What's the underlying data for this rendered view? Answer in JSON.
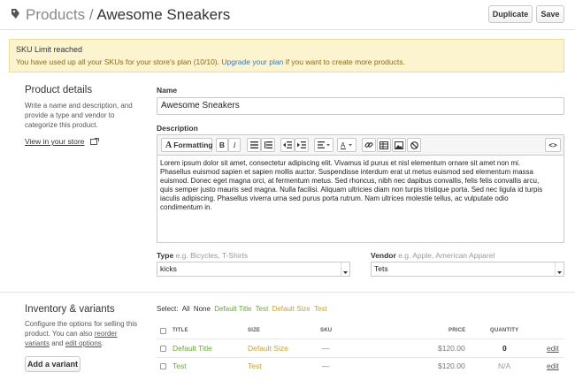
{
  "header": {
    "breadcrumb_root": "Products",
    "separator": "/",
    "title": "Awesome Sneakers",
    "duplicate_label": "Duplicate",
    "save_label": "Save"
  },
  "banner": {
    "title": "SKU Limit reached",
    "text_before": "You have used up all your SKUs for your store's plan (10/10).",
    "link": "Upgrade your plan",
    "text_after": "if you want to create more products."
  },
  "details": {
    "title": "Product details",
    "description": [
      "Write a name and description, and",
      "provide a type and vendor to",
      "categorize this product."
    ],
    "view_link": "View in your store"
  },
  "name_field": {
    "label": "Name",
    "value": "Awesome Sneakers"
  },
  "description_field": {
    "label": "Description",
    "toolbar": {
      "formatting": "Formatting",
      "bold": "B",
      "italic": "I",
      "code": "<>"
    },
    "lines": [
      "Lorem ipsum dolor sit amet, consectetur adipiscing elit. Vivamus id purus et nisl elementum ornare sit amet non mi.",
      "Phasellus euismod sapien et sapien mollis auctor. Suspendisse interdum erat ut metus euismod sed elementum massa",
      "euismod. Donec eget magna orci, at fermentum metus. Sed rhoncus, nibh nec dapibus convallis, felis felis convallis arcu,",
      "quis semper justo mauris sed magna. Nulla facilisi. Aliquam ultricies diam non turpis tristique porta. Sed nec ligula id turpis",
      "iaculis adipiscing. Phasellus viverra urna sed purus porta rutrum. Nam ultrices molestie tellus, ac vulputate odio",
      "condimentum in."
    ]
  },
  "type_field": {
    "label": "Type",
    "hint": "e.g. Bicycles, T-Shirts",
    "value": "kicks"
  },
  "vendor_field": {
    "label": "Vendor",
    "hint": "e.g. Apple, American Apparel",
    "value": "Tets"
  },
  "inventory": {
    "title": "Inventory & variants",
    "desc_line1": "Configure the options for selling this",
    "desc_line2_pre": "product. You can also",
    "reorder_link": "reorder",
    "variants_link": "variants",
    "desc_and": "and",
    "edit_options_link": "edit options",
    "desc_end": ".",
    "add_variant": "Add a variant"
  },
  "selector": {
    "label": "Select:",
    "all": "All",
    "none": "None",
    "opts": [
      "Default Title",
      "Test",
      "Default Size",
      "Test"
    ]
  },
  "table": {
    "headers": {
      "title": "TITLE",
      "size": "SIZE",
      "sku": "SKU",
      "price": "PRICE",
      "quantity": "QUANTITY"
    },
    "rows": [
      {
        "title": "Default Title",
        "size": "Default Size",
        "sku": "—",
        "price": "$120.00",
        "quantity": "0",
        "action": "edit"
      },
      {
        "title": "Test",
        "size": "Test",
        "sku": "—",
        "price": "$120.00",
        "quantity": "N/A",
        "action": "edit"
      }
    ]
  },
  "colors": {
    "link": "#3a7ab8",
    "green": "#68a63d",
    "banner_bg": "#fcf3cf"
  }
}
